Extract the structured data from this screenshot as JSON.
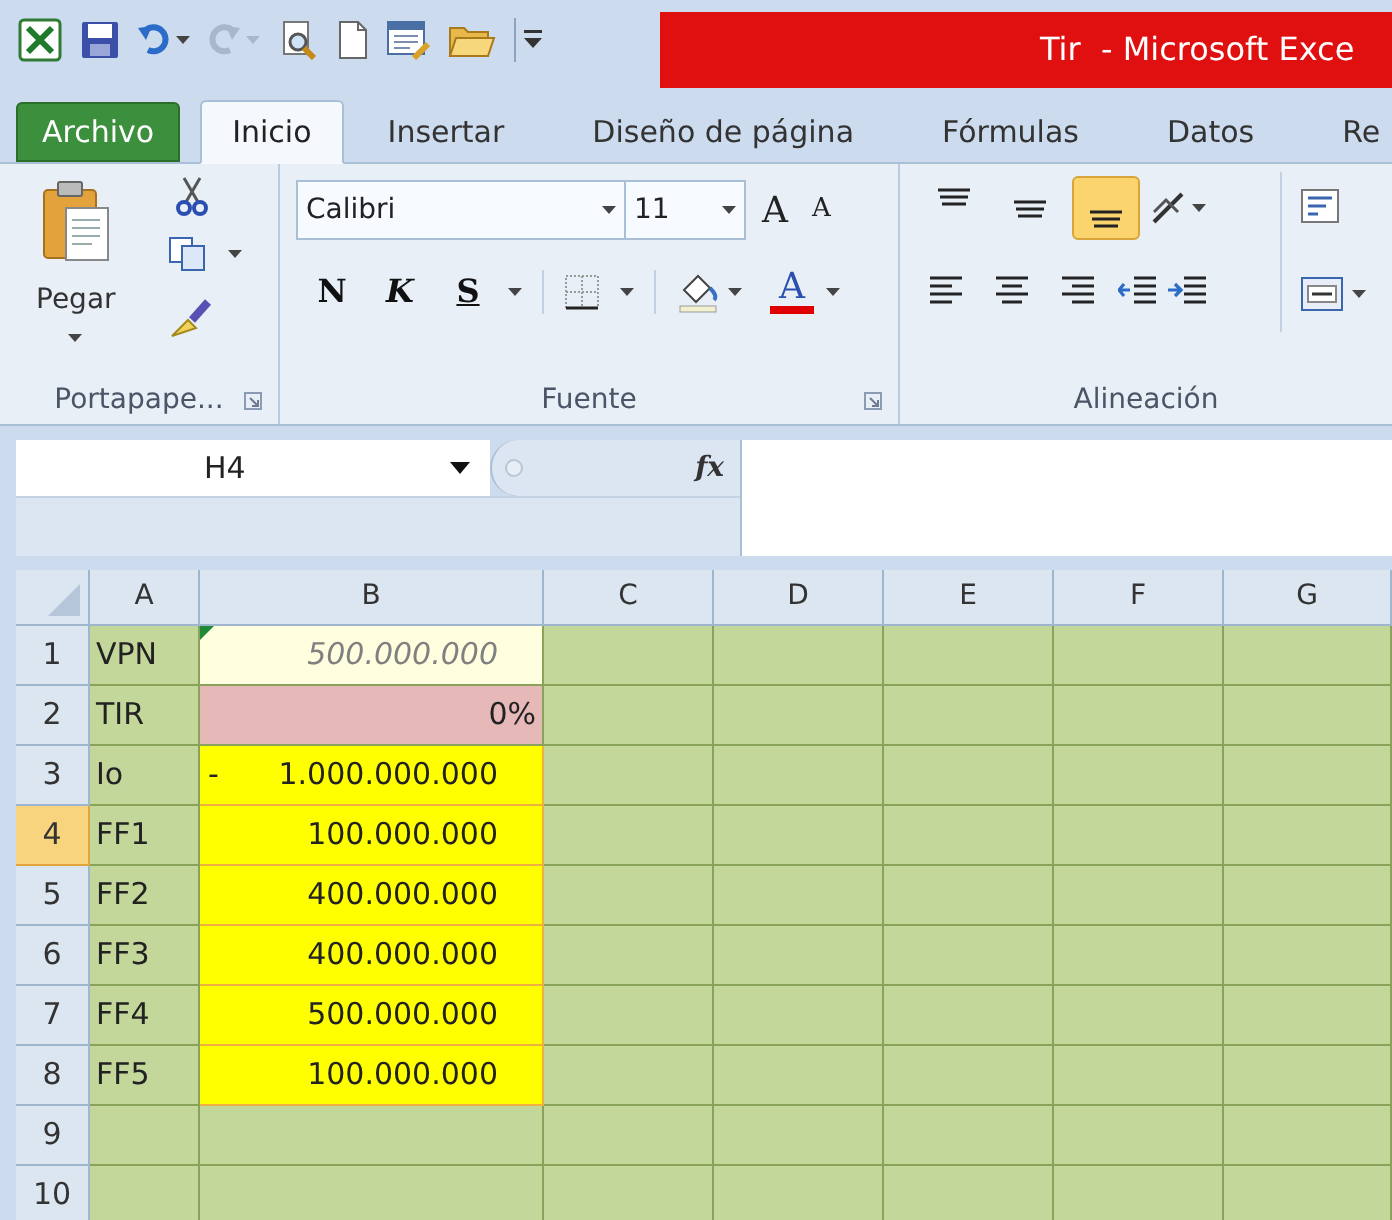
{
  "window": {
    "title": "Tir  - Microsoft Exce"
  },
  "tabs": [
    {
      "label": "Archivo",
      "kind": "file",
      "selected": false
    },
    {
      "label": "Inicio",
      "kind": "tab",
      "selected": true
    },
    {
      "label": "Insertar",
      "kind": "tab",
      "selected": false
    },
    {
      "label": "Diseño de página",
      "kind": "tab",
      "selected": false
    },
    {
      "label": "Fórmulas",
      "kind": "tab",
      "selected": false
    },
    {
      "label": "Datos",
      "kind": "tab",
      "selected": false
    },
    {
      "label": "Re",
      "kind": "tab",
      "selected": false
    }
  ],
  "ribbon": {
    "clipboard": {
      "paste_label": "Pegar",
      "group_label": "Portapape..."
    },
    "font": {
      "font_name": "Calibri",
      "font_size": "11",
      "grow_label": "A",
      "shrink_label": "A",
      "style_buttons": [
        "N",
        "K",
        "S"
      ],
      "color_label": "A",
      "group_label": "Fuente"
    },
    "alignment": {
      "vertical_buttons": [
        {
          "selected": false
        },
        {
          "selected": false
        },
        {
          "selected": true
        }
      ],
      "group_label": "Alineación"
    }
  },
  "name_box": {
    "value": "H4"
  },
  "formula_bar": {
    "function_label": "fx"
  },
  "sheet": {
    "columns": [
      "A",
      "B",
      "C",
      "D",
      "E",
      "F",
      "G"
    ],
    "rows": [
      {
        "header": "1",
        "selected": false,
        "cells": [
          {
            "kind": "label",
            "value": "VPN"
          },
          {
            "kind": "output",
            "value": "500.000.000",
            "error_mark": true
          }
        ]
      },
      {
        "header": "2",
        "selected": false,
        "cells": [
          {
            "kind": "label",
            "value": "TIR"
          },
          {
            "kind": "result",
            "value": "0%"
          }
        ]
      },
      {
        "header": "3",
        "selected": false,
        "cells": [
          {
            "kind": "label",
            "value": "Io"
          },
          {
            "kind": "input",
            "sign": "-",
            "value": "1.000.000.000"
          }
        ]
      },
      {
        "header": "4",
        "selected": true,
        "cells": [
          {
            "kind": "label",
            "value": "FF1"
          },
          {
            "kind": "input",
            "value": "100.000.000"
          }
        ]
      },
      {
        "header": "5",
        "selected": false,
        "cells": [
          {
            "kind": "label",
            "value": "FF2"
          },
          {
            "kind": "input",
            "value": "400.000.000"
          }
        ]
      },
      {
        "header": "6",
        "selected": false,
        "cells": [
          {
            "kind": "label",
            "value": "FF3"
          },
          {
            "kind": "input",
            "value": "400.000.000"
          }
        ]
      },
      {
        "header": "7",
        "selected": false,
        "cells": [
          {
            "kind": "label",
            "value": "FF4"
          },
          {
            "kind": "input",
            "value": "500.000.000"
          }
        ]
      },
      {
        "header": "8",
        "selected": false,
        "cells": [
          {
            "kind": "label",
            "value": "FF5"
          },
          {
            "kind": "input",
            "value": "100.000.000"
          }
        ]
      },
      {
        "header": "9",
        "selected": false
      },
      {
        "header": "10",
        "selected": false
      }
    ]
  }
}
